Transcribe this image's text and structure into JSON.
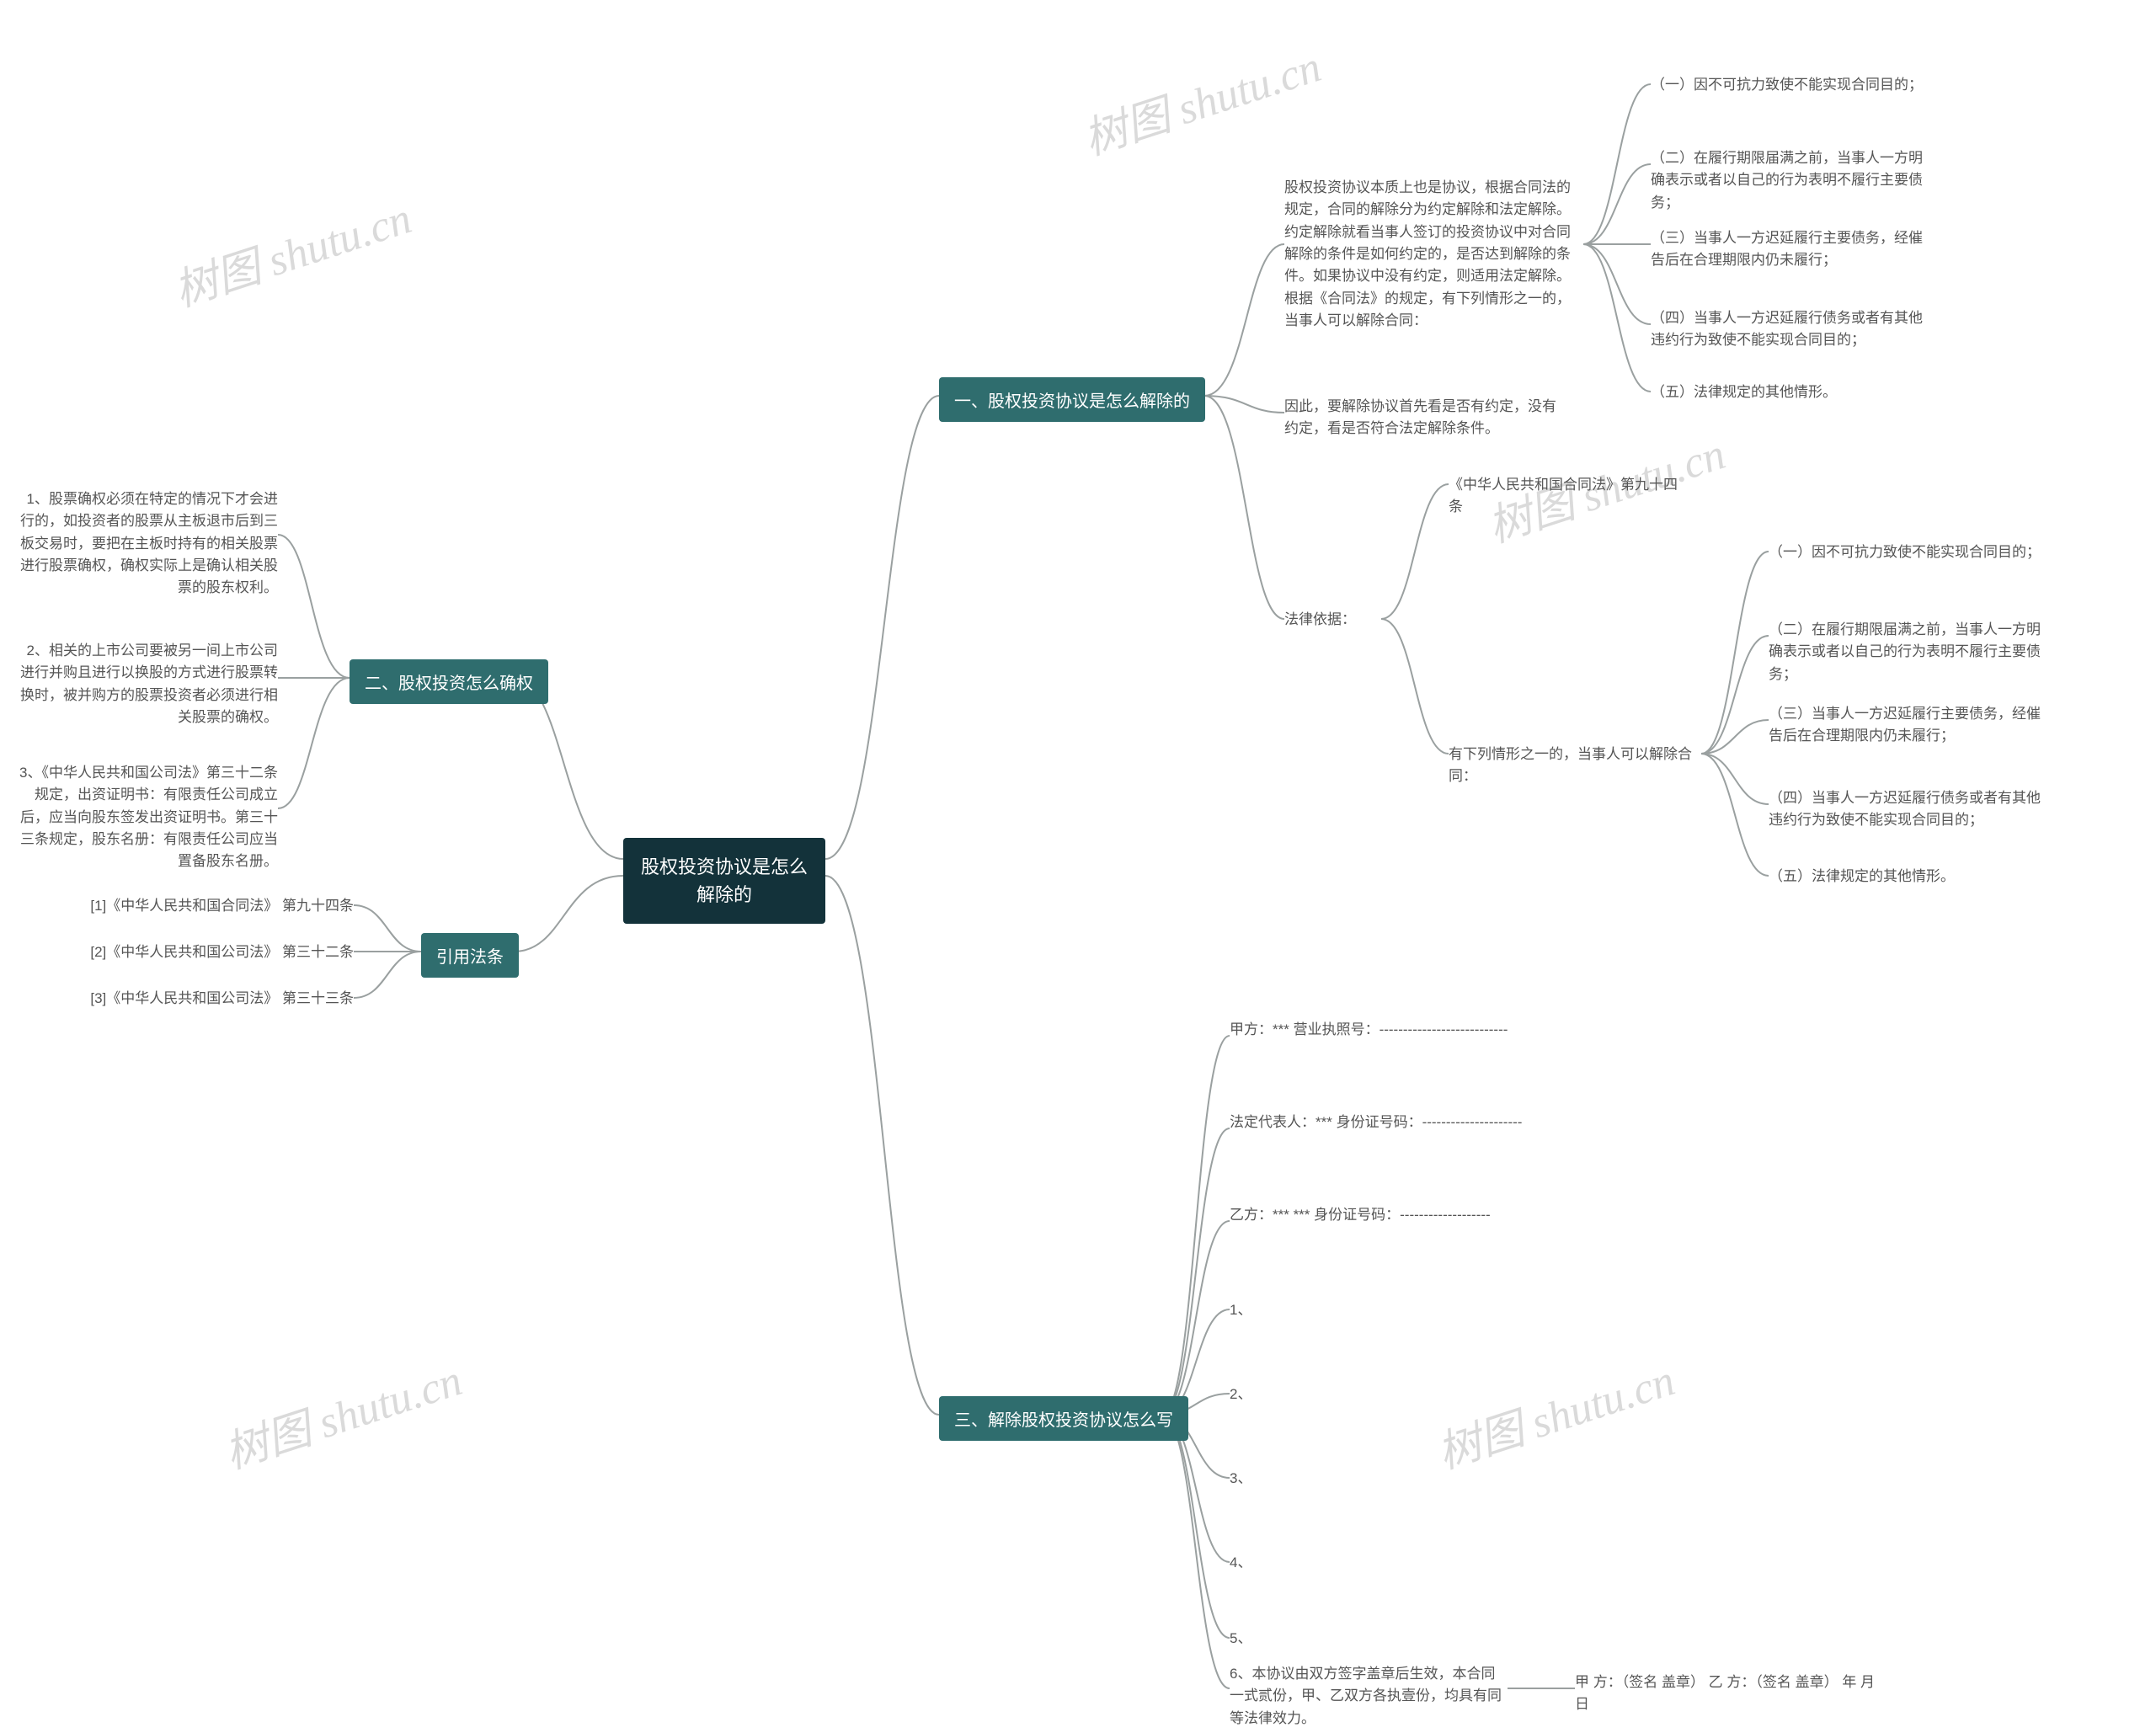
{
  "root": {
    "title": "股权投资协议是怎么解除的"
  },
  "watermark": "树图 shutu.cn",
  "B1": {
    "title": "一、股权投资协议是怎么解除的"
  },
  "B1a": {
    "text": "股权投资协议本质上也是协议，根据合同法的规定，合同的解除分为约定解除和法定解除。约定解除就看当事人签订的投资协议中对合同解除的条件是如何约定的，是否达到解除的条件。如果协议中没有约定，则适用法定解除。根据《合同法》的规定，有下列情形之一的，当事人可以解除合同："
  },
  "B1a1": {
    "text": "（一）因不可抗力致使不能实现合同目的；"
  },
  "B1a2": {
    "text": "（二）在履行期限届满之前，当事人一方明确表示或者以自己的行为表明不履行主要债务；"
  },
  "B1a3": {
    "text": "（三）当事人一方迟延履行主要债务，经催告后在合理期限内仍未履行；"
  },
  "B1a4": {
    "text": "（四）当事人一方迟延履行债务或者有其他违约行为致使不能实现合同目的；"
  },
  "B1a5": {
    "text": "（五）法律规定的其他情形。"
  },
  "B1b": {
    "text": "因此，要解除协议首先看是否有约定，没有约定，看是否符合法定解除条件。"
  },
  "B1c": {
    "title": "法律依据："
  },
  "B1c_law": {
    "text": "《中华人民共和国合同法》第九十四条"
  },
  "B1c_head": {
    "text": "有下列情形之一的，当事人可以解除合同："
  },
  "B1c1": {
    "text": "（一）因不可抗力致使不能实现合同目的；"
  },
  "B1c2": {
    "text": "（二）在履行期限届满之前，当事人一方明确表示或者以自己的行为表明不履行主要债务；"
  },
  "B1c3": {
    "text": "（三）当事人一方迟延履行主要债务，经催告后在合理期限内仍未履行；"
  },
  "B1c4": {
    "text": "（四）当事人一方迟延履行债务或者有其他违约行为致使不能实现合同目的；"
  },
  "B1c5": {
    "text": "（五）法律规定的其他情形。"
  },
  "B2": {
    "title": "二、股权投资怎么确权"
  },
  "B2a": {
    "text": "1、股票确权必须在特定的情况下才会进行的，如投资者的股票从主板退市后到三板交易时，要把在主板时持有的相关股票进行股票确权，确权实际上是确认相关股票的股东权利。"
  },
  "B2b": {
    "text": "2、相关的上市公司要被另一间上市公司进行并购且进行以换股的方式进行股票转换时，被并购方的股票投资者必须进行相关股票的确权。"
  },
  "B2c": {
    "text": "3、《中华人民共和国公司法》第三十二条规定，出资证明书：有限责任公司成立后，应当向股东签发出资证明书。第三十三条规定，股东名册：有限责任公司应当置备股东名册。"
  },
  "B3": {
    "title": "三、解除股权投资协议怎么写"
  },
  "B3a": {
    "text": "甲方：*** 营业执照号：---------------------------"
  },
  "B3b": {
    "text": "法定代表人：*** 身份证号码：---------------------"
  },
  "B3c": {
    "text": "乙方：*** *** 身份证号码：-------------------"
  },
  "B3d": {
    "text": "1、"
  },
  "B3e": {
    "text": "2、"
  },
  "B3f": {
    "text": "3、"
  },
  "B3g": {
    "text": "4、"
  },
  "B3h": {
    "text": "5、"
  },
  "B3i": {
    "text": "6、本协议由双方签字盖章后生效，本合同一式贰份，甲、乙双方各执壹份，均具有同等法律效力。"
  },
  "B3i_sig": {
    "text": "甲 方：（签名 盖章） 乙 方：（签名 盖章） 年 月 日"
  },
  "B4": {
    "title": "引用法条"
  },
  "B4a": {
    "text": "[1]《中华人民共和国合同法》 第九十四条"
  },
  "B4b": {
    "text": "[2]《中华人民共和国公司法》 第三十二条"
  },
  "B4c": {
    "text": "[3]《中华人民共和国公司法》 第三十三条"
  }
}
